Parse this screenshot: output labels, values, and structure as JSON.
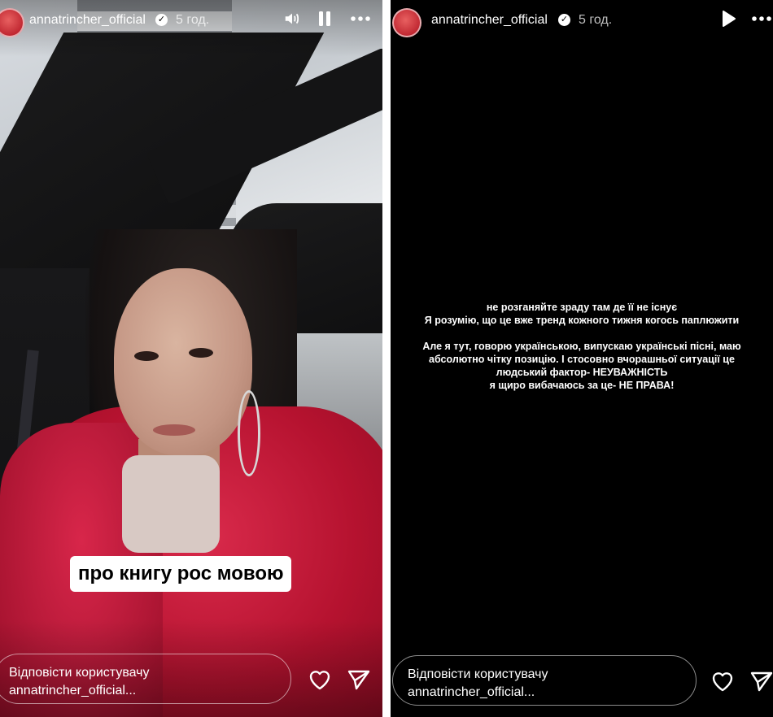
{
  "stories": [
    {
      "username": "annatrincher_official",
      "time": "5 год.",
      "caption": "про книгу рос мовою",
      "reply_line1": "Відповісти користувачу",
      "reply_line2": "annatrincher_official..."
    },
    {
      "username": "annatrincher_official",
      "time": "5 год.",
      "text_lines": [
        "не розганяйте зраду там де її не існує",
        "Я розумію, що це вже тренд кожного тижня когось паплюжити",
        "Але я тут, говорю українською, випускаю українські пісні, маю",
        "абсолютно чітку позицію. І стосовно вчорашньої ситуації це",
        "людський фактор- НЕУВАЖНІСТЬ",
        "я щиро вибачаюсь за це- НЕ ПРАВА!"
      ],
      "reply_line1": "Відповісти користувачу",
      "reply_line2": "annatrincher_official..."
    }
  ],
  "icons": {
    "verified": "verified-badge-icon",
    "mute": "speaker-icon",
    "pause": "pause-icon",
    "play": "play-icon",
    "more": "more-icon",
    "like": "heart-icon",
    "share": "send-icon"
  },
  "colors": {
    "story_bg": "#000000",
    "coat_red": "#b5122f",
    "text": "#ffffff"
  }
}
